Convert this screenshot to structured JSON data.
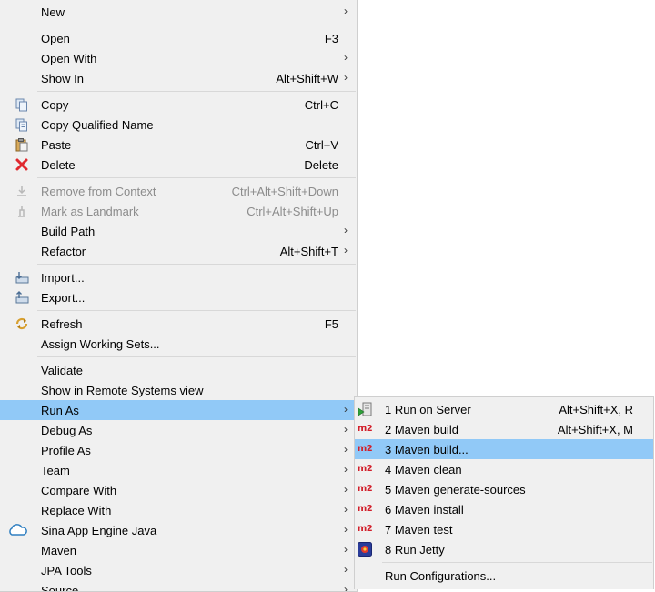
{
  "main_menu": {
    "g1": {
      "new": "New"
    },
    "g2": {
      "open": {
        "label": "Open",
        "shortcut": "F3"
      },
      "open_with": {
        "label": "Open With"
      },
      "show_in": {
        "label": "Show In",
        "shortcut": "Alt+Shift+W"
      }
    },
    "g3": {
      "copy": {
        "label": "Copy",
        "shortcut": "Ctrl+C",
        "icon": "copy-icon"
      },
      "copy_qualified": {
        "label": "Copy Qualified Name",
        "icon": "copy-qualified-icon"
      },
      "paste": {
        "label": "Paste",
        "shortcut": "Ctrl+V",
        "icon": "paste-icon"
      },
      "delete": {
        "label": "Delete",
        "shortcut": "Delete",
        "icon": "delete-icon",
        "icon_color": "#e0282e"
      }
    },
    "g4": {
      "remove_context": {
        "label": "Remove from Context",
        "shortcut": "Ctrl+Alt+Shift+Down",
        "disabled": true
      },
      "mark_landmark": {
        "label": "Mark as Landmark",
        "shortcut": "Ctrl+Alt+Shift+Up",
        "disabled": true
      },
      "build_path": {
        "label": "Build Path"
      },
      "refactor": {
        "label": "Refactor",
        "shortcut": "Alt+Shift+T"
      }
    },
    "g5": {
      "import": {
        "label": "Import...",
        "icon": "import-icon"
      },
      "export": {
        "label": "Export...",
        "icon": "export-icon"
      }
    },
    "g6": {
      "refresh": {
        "label": "Refresh",
        "shortcut": "F5",
        "icon": "refresh-icon"
      },
      "assign_working_sets": {
        "label": "Assign Working Sets..."
      }
    },
    "g7": {
      "validate": {
        "label": "Validate"
      },
      "show_remote": {
        "label": "Show in Remote Systems view"
      },
      "run_as": {
        "label": "Run As",
        "selected": true
      },
      "debug_as": {
        "label": "Debug As"
      },
      "profile_as": {
        "label": "Profile As"
      },
      "team": {
        "label": "Team"
      },
      "compare_with": {
        "label": "Compare With"
      },
      "replace_with": {
        "label": "Replace With"
      },
      "sina": {
        "label": "Sina App Engine Java",
        "icon": "cloud-icon"
      },
      "maven": {
        "label": "Maven"
      },
      "jpa_tools": {
        "label": "JPA Tools"
      },
      "source": {
        "label": "Source"
      }
    }
  },
  "sub_menu": {
    "run_on_server": {
      "label": "1 Run on Server",
      "shortcut": "Alt+Shift+X, R",
      "icon": "server-run-icon"
    },
    "maven_build": {
      "label": "2 Maven build",
      "shortcut": "Alt+Shift+X, M",
      "icon": "m2"
    },
    "maven_build_dots": {
      "label": "3 Maven build...",
      "icon": "m2",
      "selected": true
    },
    "maven_clean": {
      "label": "4 Maven clean",
      "icon": "m2"
    },
    "maven_generate": {
      "label": "5 Maven generate-sources",
      "icon": "m2"
    },
    "maven_install": {
      "label": "6 Maven install",
      "icon": "m2"
    },
    "maven_test": {
      "label": "7 Maven test",
      "icon": "m2"
    },
    "run_jetty": {
      "label": "8 Run Jetty",
      "icon": "jetty-icon"
    },
    "run_configs": {
      "label": "Run Configurations..."
    }
  },
  "glyphs": {
    "submenu_arrow": "›",
    "m2": "m2"
  }
}
